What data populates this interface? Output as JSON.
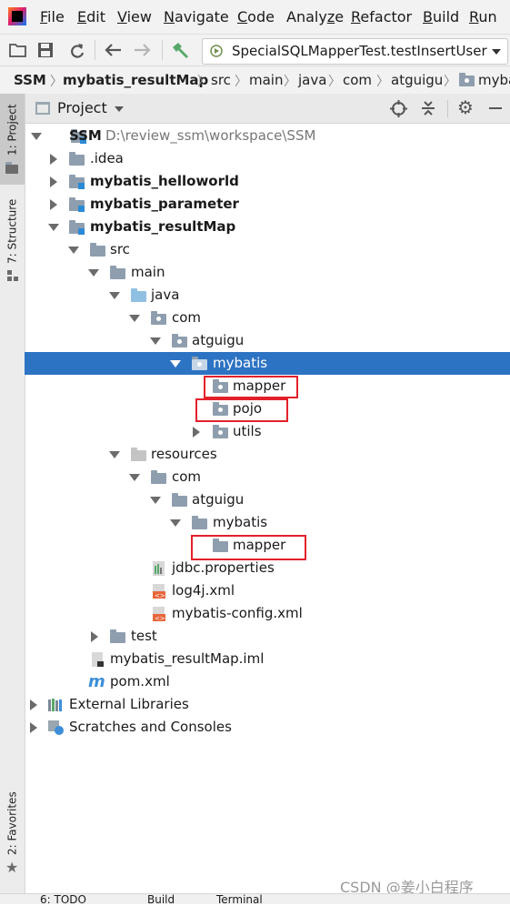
{
  "menubar": {
    "items": [
      "File",
      "Edit",
      "View",
      "Navigate",
      "Code",
      "Analyze",
      "Refactor",
      "Build",
      "Run"
    ],
    "mnemonics": [
      "F",
      "E",
      "V",
      "N",
      "C",
      "z",
      "R",
      "B",
      "R"
    ]
  },
  "toolbar": {
    "run_config": "SpecialSQLMapperTest.testInsertUser"
  },
  "breadcrumb": [
    "SSM",
    "mybatis_resultMap",
    "src",
    "main",
    "java",
    "com",
    "atguigu",
    "myba"
  ],
  "tool_windows": {
    "project_tab": "1: Project",
    "structure_tab": "7: Structure",
    "favorites_tab": "2: Favorites"
  },
  "project_panel": {
    "title": "Project"
  },
  "tree": [
    {
      "label": "SSM",
      "path": "D:\\review_ssm\\workspace\\SSM",
      "bold": true
    },
    {
      "label": ".idea"
    },
    {
      "label": "mybatis_helloworld",
      "bold": true
    },
    {
      "label": "mybatis_parameter",
      "bold": true
    },
    {
      "label": "mybatis_resultMap",
      "bold": true
    },
    {
      "label": "src"
    },
    {
      "label": "main"
    },
    {
      "label": "java"
    },
    {
      "label": "com"
    },
    {
      "label": "atguigu"
    },
    {
      "label": "mybatis"
    },
    {
      "label": "mapper"
    },
    {
      "label": "pojo"
    },
    {
      "label": "utils"
    },
    {
      "label": "resources"
    },
    {
      "label": "com"
    },
    {
      "label": "atguigu"
    },
    {
      "label": "mybatis"
    },
    {
      "label": "mapper"
    },
    {
      "label": "jdbc.properties"
    },
    {
      "label": "log4j.xml"
    },
    {
      "label": "mybatis-config.xml"
    },
    {
      "label": "test"
    },
    {
      "label": "mybatis_resultMap.iml"
    },
    {
      "label": "pom.xml"
    },
    {
      "label": "External Libraries"
    },
    {
      "label": "Scratches and Consoles"
    }
  ],
  "watermark": "CSDN @姜小白程序",
  "bottom_tabs": [
    "6: TODO",
    "Build",
    "Terminal"
  ]
}
